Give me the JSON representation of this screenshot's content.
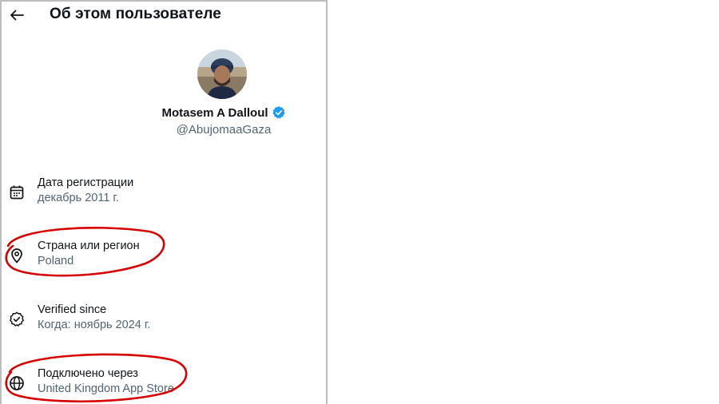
{
  "header": {
    "title": "Об этом пользователе",
    "back_icon": "arrow-left-icon"
  },
  "profile": {
    "display_name": "Motasem A Dalloul",
    "handle": "@AbujomaaGaza",
    "verified_icon": "verified-badge-icon",
    "verified_color": "#1d9bf0"
  },
  "info": [
    {
      "icon": "calendar-icon",
      "label": "Дата регистрации",
      "value": "декабрь 2011 г."
    },
    {
      "icon": "location-pin-icon",
      "label": "Страна или регион",
      "value": "Poland"
    },
    {
      "icon": "verified-check-icon",
      "label": "Verified since",
      "value": "Когда: ноябрь 2024 г."
    },
    {
      "icon": "globe-icon",
      "label": "Подключено через",
      "value": "United Kingdom App Store"
    }
  ],
  "annotations": {
    "highlight_color": "#d60000"
  }
}
